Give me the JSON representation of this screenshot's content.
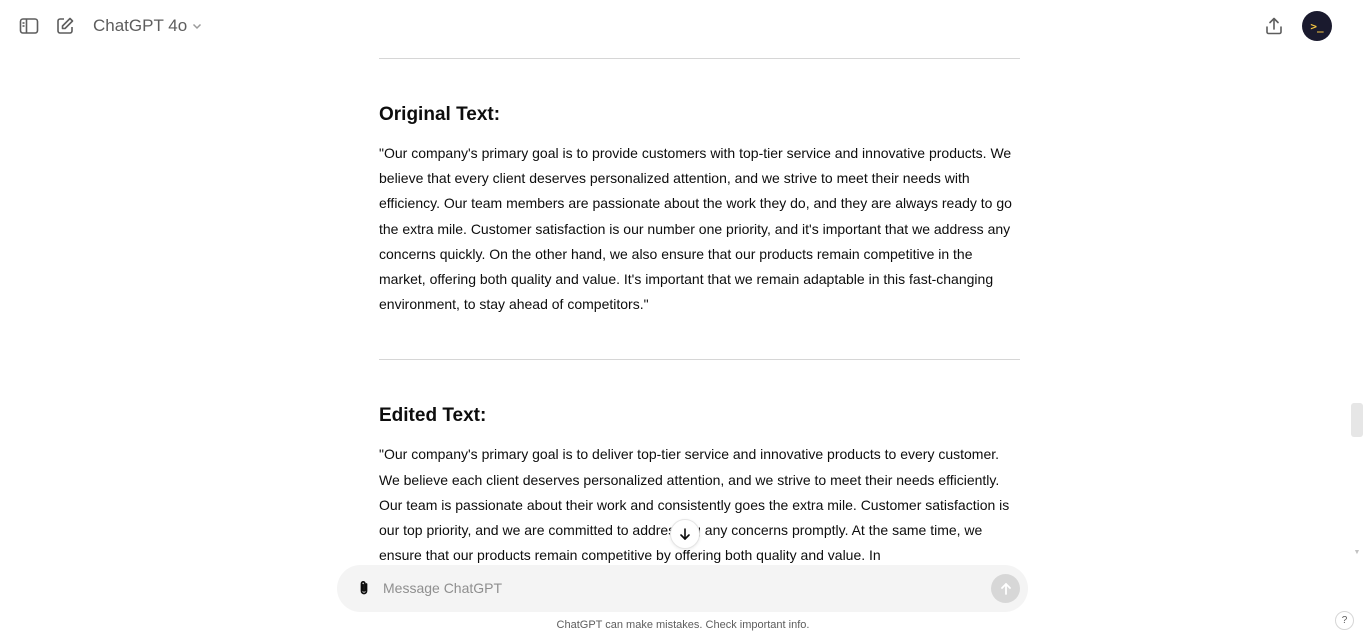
{
  "header": {
    "model_name": "ChatGPT 4o",
    "avatar_text": ">_"
  },
  "conversation": {
    "original": {
      "title": "Original Text:",
      "body": "\"Our company's primary goal is to provide customers with top-tier service and innovative products. We believe that every client deserves personalized attention, and we strive to meet their needs with efficiency. Our team members are passionate about the work they do, and they are always ready to go the extra mile. Customer satisfaction is our number one priority, and it's important that we address any concerns quickly. On the other hand, we also ensure that our products remain competitive in the market, offering both quality and value. It's important that we remain adaptable in this fast-changing environment, to stay ahead of competitors.\""
    },
    "edited": {
      "title": "Edited Text:",
      "body": "\"Our company's primary goal is to deliver top-tier service and innovative products to every customer. We believe each client deserves personalized attention, and we strive to meet their needs efficiently. Our team is passionate about their work and consistently goes the extra mile. Customer satisfaction is our top priority, and we are committed to addressing any concerns promptly. At the same time, we ensure that our products remain competitive by offering both quality and value. In"
    }
  },
  "composer": {
    "placeholder": "Message ChatGPT"
  },
  "footer": {
    "disclaimer": "ChatGPT can make mistakes. Check important info.",
    "help_label": "?"
  },
  "icons": {
    "sidebar_toggle": "sidebar-toggle-icon",
    "new_chat": "new-chat-icon",
    "chevron": "chevron-down-icon",
    "share": "share-icon",
    "attach": "paperclip-icon",
    "send": "arrow-up-icon",
    "scroll_down": "arrow-down-icon"
  },
  "colors": {
    "send_disabled": "#d7d7d7",
    "composer_bg": "#f4f4f4",
    "avatar_bg": "#1a1a2e",
    "avatar_fg": "#f5c542"
  }
}
